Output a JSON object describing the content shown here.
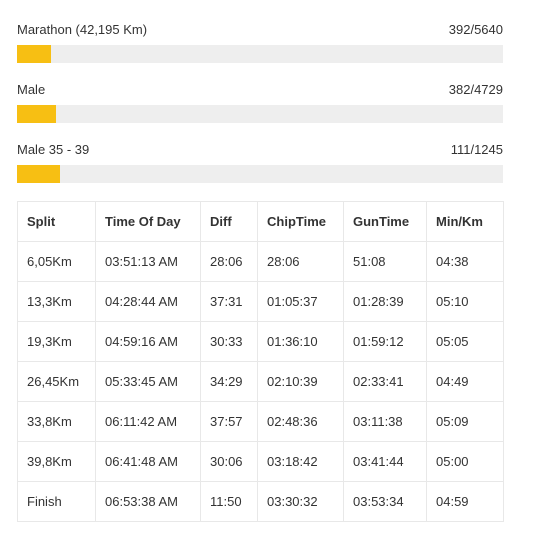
{
  "rankings": [
    {
      "label": "Marathon (42,195 Km)",
      "value": "392/5640",
      "progress": 0.0695
    },
    {
      "label": "Male",
      "value": "382/4729",
      "progress": 0.0808
    },
    {
      "label": "Male 35 - 39",
      "value": "111/1245",
      "progress": 0.0892
    }
  ],
  "table": {
    "headers": [
      "Split",
      "Time Of Day",
      "Diff",
      "ChipTime",
      "GunTime",
      "Min/Km"
    ],
    "rows": [
      [
        "6,05Km",
        "03:51:13 AM",
        "28:06",
        "28:06",
        "51:08",
        "04:38"
      ],
      [
        "13,3Km",
        "04:28:44 AM",
        "37:31",
        "01:05:37",
        "01:28:39",
        "05:10"
      ],
      [
        "19,3Km",
        "04:59:16 AM",
        "30:33",
        "01:36:10",
        "01:59:12",
        "05:05"
      ],
      [
        "26,45Km",
        "05:33:45 AM",
        "34:29",
        "02:10:39",
        "02:33:41",
        "04:49"
      ],
      [
        "33,8Km",
        "06:11:42 AM",
        "37:57",
        "02:48:36",
        "03:11:38",
        "05:09"
      ],
      [
        "39,8Km",
        "06:41:48 AM",
        "30:06",
        "03:18:42",
        "03:41:44",
        "05:00"
      ],
      [
        "Finish",
        "06:53:38 AM",
        "11:50",
        "03:30:32",
        "03:53:34",
        "04:59"
      ]
    ]
  },
  "colors": {
    "bar_fill": "#f7bf13",
    "bar_track": "#eeeeee"
  }
}
